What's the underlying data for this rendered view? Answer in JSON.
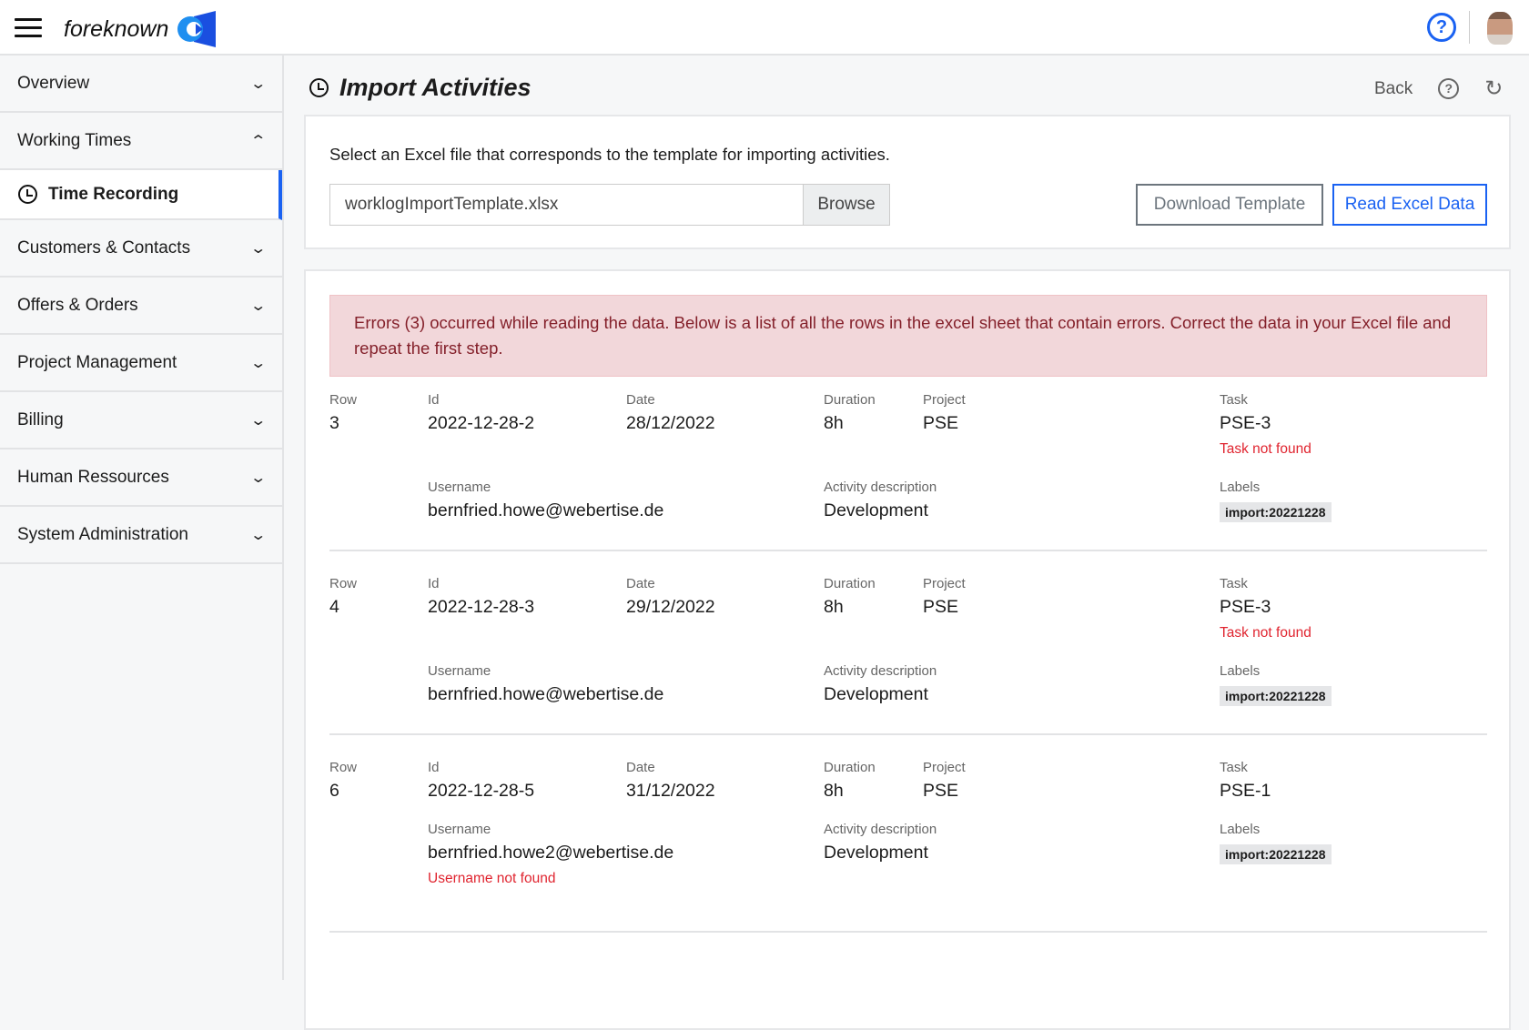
{
  "header": {
    "brand": "foreknown",
    "help_icon": "question-circle-icon",
    "accent": "#1a62f2"
  },
  "sidebar": {
    "items": [
      {
        "label": "Overview",
        "expanded": false
      },
      {
        "label": "Working Times",
        "expanded": true
      },
      {
        "label": "Time Recording",
        "active": true
      },
      {
        "label": "Customers & Contacts",
        "expanded": false
      },
      {
        "label": "Offers & Orders",
        "expanded": false
      },
      {
        "label": "Project Management",
        "expanded": false
      },
      {
        "label": "Billing",
        "expanded": false
      },
      {
        "label": "Human Ressources",
        "expanded": false
      },
      {
        "label": "System Administration",
        "expanded": false
      }
    ]
  },
  "page": {
    "title": "Import Activities",
    "back": "Back"
  },
  "import": {
    "intro": "Select an Excel file that corresponds to the template for importing activities.",
    "file_value": "worklogImportTemplate.xlsx",
    "browse": "Browse",
    "download_template": "Download Template",
    "read_excel": "Read Excel Data"
  },
  "alert": "Errors (3) occurred while reading the data. Below is a list of all the rows in the excel sheet that contain errors. Correct the data in your Excel file and repeat the first step.",
  "labels": {
    "row": "Row",
    "id": "Id",
    "date": "Date",
    "duration": "Duration",
    "project": "Project",
    "task": "Task",
    "username": "Username",
    "activity": "Activity description",
    "labels": "Labels"
  },
  "records": [
    {
      "row": "3",
      "id": "2022-12-28-2",
      "date": "28/12/2022",
      "duration": "8h",
      "project": "PSE",
      "task": "PSE-3",
      "task_error": "Task not found",
      "username": "bernfried.howe@webertise.de",
      "username_error": "",
      "activity": "Development",
      "tag": "import:20221228"
    },
    {
      "row": "4",
      "id": "2022-12-28-3",
      "date": "29/12/2022",
      "duration": "8h",
      "project": "PSE",
      "task": "PSE-3",
      "task_error": "Task not found",
      "username": "bernfried.howe@webertise.de",
      "username_error": "",
      "activity": "Development",
      "tag": "import:20221228"
    },
    {
      "row": "6",
      "id": "2022-12-28-5",
      "date": "31/12/2022",
      "duration": "8h",
      "project": "PSE",
      "task": "PSE-1",
      "task_error": "",
      "username": "bernfried.howe2@webertise.de",
      "username_error": "Username not found",
      "activity": "Development",
      "tag": "import:20221228"
    }
  ]
}
